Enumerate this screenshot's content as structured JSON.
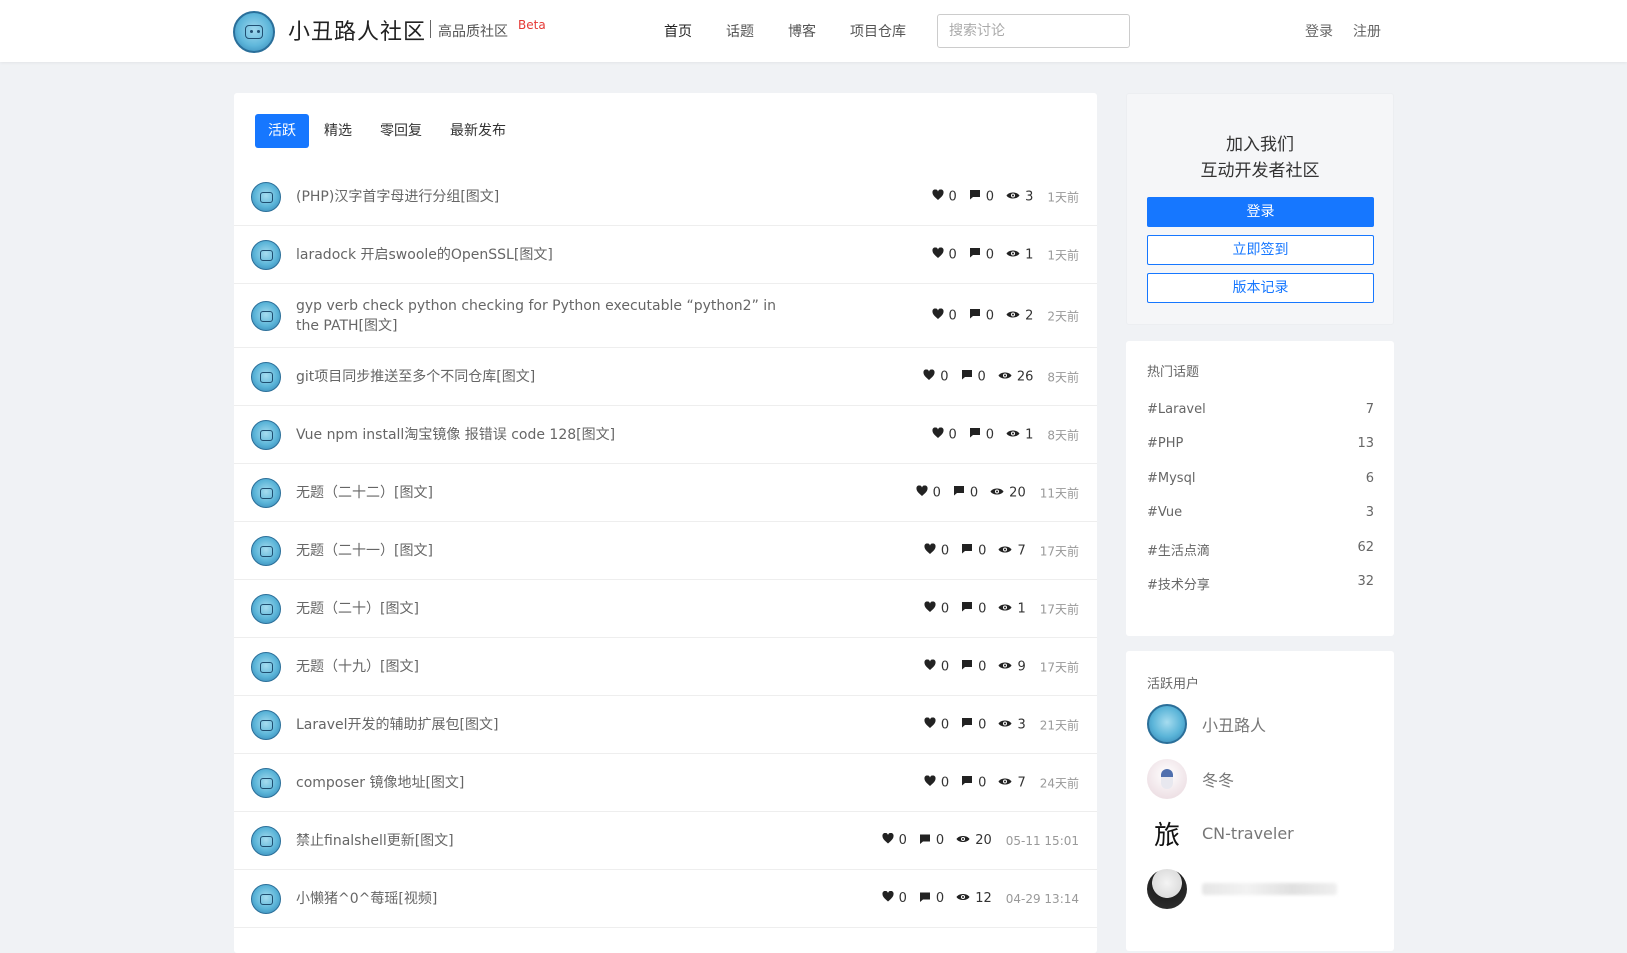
{
  "header": {
    "site_name": "小丑路人社区",
    "tagline": "高品质社区",
    "beta": "Beta",
    "nav": [
      "首页",
      "话题",
      "博客",
      "项目仓库"
    ],
    "search_placeholder": "搜索讨论",
    "login": "登录",
    "register": "注册"
  },
  "tabs": [
    "活跃",
    "精选",
    "零回复",
    "最新发布"
  ],
  "posts": [
    {
      "title": "(PHP)汉字首字母进行分组[图文]",
      "likes": "0",
      "comments": "0",
      "views": "3",
      "time": "1天前"
    },
    {
      "title": "laradock 开启swoole的OpenSSL[图文]",
      "likes": "0",
      "comments": "0",
      "views": "1",
      "time": "1天前"
    },
    {
      "title": "gyp verb check python checking for Python executable “python2” in the PATH[图文]",
      "likes": "0",
      "comments": "0",
      "views": "2",
      "time": "2天前"
    },
    {
      "title": "git项目同步推送至多个不同仓库[图文]",
      "likes": "0",
      "comments": "0",
      "views": "26",
      "time": "8天前"
    },
    {
      "title": "Vue npm install淘宝镜像 报错误 code 128[图文]",
      "likes": "0",
      "comments": "0",
      "views": "1",
      "time": "8天前"
    },
    {
      "title": "无题（二十二）[图文]",
      "likes": "0",
      "comments": "0",
      "views": "20",
      "time": "11天前"
    },
    {
      "title": "无题（二十一）[图文]",
      "likes": "0",
      "comments": "0",
      "views": "7",
      "time": "17天前"
    },
    {
      "title": "无题（二十）[图文]",
      "likes": "0",
      "comments": "0",
      "views": "1",
      "time": "17天前"
    },
    {
      "title": "无题（十九）[图文]",
      "likes": "0",
      "comments": "0",
      "views": "9",
      "time": "17天前"
    },
    {
      "title": "Laravel开发的辅助扩展包[图文]",
      "likes": "0",
      "comments": "0",
      "views": "3",
      "time": "21天前"
    },
    {
      "title": "composer 镜像地址[图文]",
      "likes": "0",
      "comments": "0",
      "views": "7",
      "time": "24天前"
    },
    {
      "title": "禁止finalshell更新[图文]",
      "likes": "0",
      "comments": "0",
      "views": "20",
      "time": "05-11 15:01"
    },
    {
      "title": "小懒猪^0^莓瑶[视频]",
      "likes": "0",
      "comments": "0",
      "views": "12",
      "time": "04-29 13:14"
    }
  ],
  "join": {
    "line1": "加入我们",
    "line2": "互动开发者社区",
    "login": "登录",
    "checkin": "立即签到",
    "changelog": "版本记录"
  },
  "hot_topics": {
    "title": "热门话题",
    "items": [
      {
        "name": "#Laravel",
        "count": "7"
      },
      {
        "name": "#PHP",
        "count": "13"
      },
      {
        "name": "#Mysql",
        "count": "6"
      },
      {
        "name": "#Vue",
        "count": "3"
      },
      {
        "name": "#生活点滴",
        "count": "62"
      },
      {
        "name": "#技术分享",
        "count": "32"
      }
    ]
  },
  "active_users": {
    "title": "活跃用户",
    "users": [
      {
        "name": "小丑路人"
      },
      {
        "name": "冬冬"
      },
      {
        "name": "CN-traveler",
        "glyph": "旅"
      }
    ]
  },
  "colors": {
    "accent": "#1677ff",
    "beta": "#e53935"
  }
}
